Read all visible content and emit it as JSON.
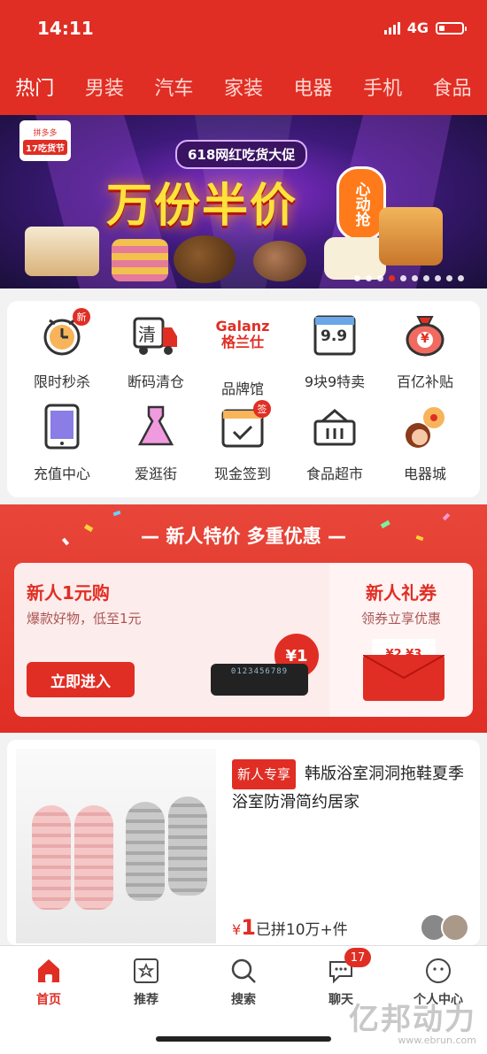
{
  "status_bar": {
    "time": "14:11",
    "network": "4G"
  },
  "categories": [
    {
      "label": "热门",
      "active": true
    },
    {
      "label": "男装"
    },
    {
      "label": "汽车"
    },
    {
      "label": "家装"
    },
    {
      "label": "电器"
    },
    {
      "label": "手机"
    },
    {
      "label": "食品"
    }
  ],
  "banner": {
    "badge_line1": "拼多多",
    "badge_line2": "17吃货节",
    "subtitle": "618网红吃货大促",
    "headline": "万份半价",
    "side_text": "心动抢"
  },
  "grid": [
    {
      "label": "限时秒杀",
      "badge": "新",
      "icon": "alarm-clock-icon"
    },
    {
      "label": "断码清仓",
      "icon_text": "清",
      "icon": "clearance-truck-icon"
    },
    {
      "label": "品牌馆",
      "icon_line1": "Galanz",
      "icon_line2": "格兰仕",
      "icon": "galanz-logo-icon"
    },
    {
      "label": "9块9特卖",
      "icon_text": "9.9",
      "icon": "calendar-99-icon"
    },
    {
      "label": "百亿补贴",
      "icon_text": "¥",
      "icon": "money-bag-icon"
    },
    {
      "label": "充值中心",
      "icon": "tablet-icon"
    },
    {
      "label": "爱逛街",
      "icon": "dress-icon"
    },
    {
      "label": "现金签到",
      "badge": "签",
      "icon": "calendar-check-icon"
    },
    {
      "label": "食品超市",
      "icon": "basket-icon"
    },
    {
      "label": "电器城",
      "icon": "girl-fan-icon"
    }
  ],
  "promo": {
    "title": "— 新人特价 多重优惠 —",
    "left_title": "新人1元购",
    "left_sub": "爆款好物，低至1元",
    "button": "立即进入",
    "coin": "¥1",
    "plate_digits": "0123456789",
    "right_title": "新人礼券",
    "right_sub": "领券立享优惠",
    "coupon_text": "¥2 ¥3"
  },
  "product": {
    "tag": "新人专享",
    "title": "韩版浴室洞洞拖鞋夏季浴室防滑简约居家",
    "price_symbol": "¥",
    "price": "1",
    "sold": "已拼10万+件"
  },
  "bottom_nav": [
    {
      "label": "首页",
      "icon": "home-icon",
      "active": true
    },
    {
      "label": "推荐",
      "icon": "star-card-icon"
    },
    {
      "label": "搜索",
      "icon": "search-icon"
    },
    {
      "label": "聊天",
      "icon": "chat-icon",
      "badge": "17"
    },
    {
      "label": "个人中心",
      "icon": "profile-icon"
    }
  ],
  "watermark": {
    "line1": "亿邦动力",
    "line2": "www.ebrun.com"
  },
  "colors": {
    "brand_red": "#e02e24",
    "banner_purple": "#3d1a7a"
  }
}
